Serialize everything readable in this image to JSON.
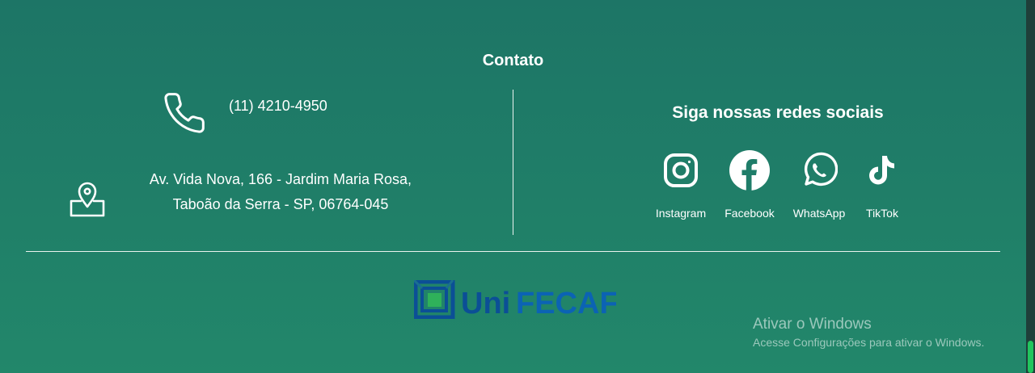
{
  "footer": {
    "contact_title": "Contato",
    "phone": "(11) 4210-4950",
    "address_line1": "Av. Vida Nova, 166 - Jardim Maria Rosa,",
    "address_line2": "Taboão da Serra - SP, 06764-045",
    "social_title": "Siga nossas redes sociais",
    "social": [
      {
        "label": "Instagram",
        "icon": "instagram-icon"
      },
      {
        "label": "Facebook",
        "icon": "facebook-icon"
      },
      {
        "label": "WhatsApp",
        "icon": "whatsapp-icon"
      },
      {
        "label": "TikTok",
        "icon": "tiktok-icon"
      }
    ],
    "logo": {
      "text_uni": "Uni",
      "text_fecaf": "FECAF"
    }
  },
  "watermark": {
    "line1": "Ativar o Windows",
    "line2": "Acesse Configurações para ativar o Windows."
  },
  "colors": {
    "background_top": "#1d7566",
    "background_bottom": "#22876a",
    "logo_blue": "#0b4f96",
    "logo_green": "#2fb15a",
    "scroll_thumb": "#22c55e"
  }
}
